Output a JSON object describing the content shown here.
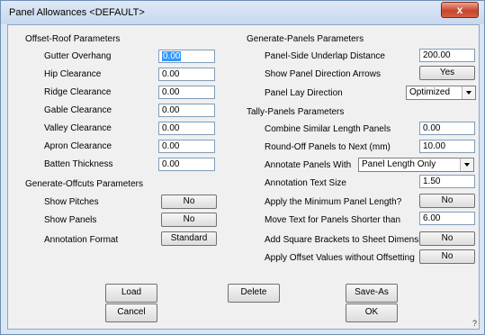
{
  "window": {
    "title": "Panel Allowances <DEFAULT>",
    "close_glyph": "x"
  },
  "offset_roof": {
    "heading": "Offset-Roof Parameters",
    "rows": [
      {
        "label": "Gutter Overhang",
        "value": "0.00"
      },
      {
        "label": "Hip Clearance",
        "value": "0.00"
      },
      {
        "label": "Ridge Clearance",
        "value": "0.00"
      },
      {
        "label": "Gable Clearance",
        "value": "0.00"
      },
      {
        "label": "Valley Clearance",
        "value": "0.00"
      },
      {
        "label": "Apron Clearance",
        "value": "0.00"
      },
      {
        "label": "Batten Thickness",
        "value": "0.00"
      }
    ]
  },
  "offcuts": {
    "heading": "Generate-Offcuts Parameters",
    "rows": [
      {
        "label": "Show Pitches",
        "value": "No"
      },
      {
        "label": "Show Panels",
        "value": "No"
      },
      {
        "label": "Annotation Format",
        "value": "Standard"
      }
    ]
  },
  "generate_panels": {
    "heading": "Generate-Panels Parameters",
    "underlap": {
      "label": "Panel-Side Underlap Distance",
      "value": "200.00"
    },
    "arrows": {
      "label": "Show Panel Direction Arrows",
      "value": "Yes"
    },
    "lay_direction": {
      "label": "Panel Lay Direction",
      "value": "Optimized"
    }
  },
  "tally_panels": {
    "heading": "Tally-Panels Parameters",
    "combine": {
      "label": "Combine Similar Length Panels",
      "value": "0.00"
    },
    "roundoff": {
      "label": "Round-Off Panels to Next (mm)",
      "value": "10.00"
    },
    "annotate": {
      "label": "Annotate Panels With",
      "value": "Panel Length Only"
    },
    "text_size": {
      "label": "Annotation Text Size",
      "value": "1.50"
    },
    "min_length": {
      "label": "Apply the Minimum Panel Length?",
      "value": "No"
    },
    "move_text": {
      "label": "Move Text for Panels Shorter than",
      "value": "6.00"
    },
    "brackets": {
      "label": "Add Square Brackets to Sheet Dimension",
      "value": "No"
    },
    "offset_values": {
      "label": "Apply Offset Values without Offsetting",
      "value": "No"
    }
  },
  "buttons": {
    "load": "Load",
    "delete": "Delete",
    "save_as": "Save-As",
    "cancel": "Cancel",
    "ok": "OK"
  },
  "grip": "?"
}
